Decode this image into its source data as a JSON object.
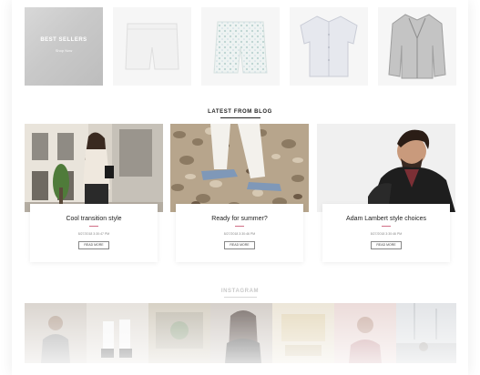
{
  "best_sellers": {
    "title": "BEST SELLERS",
    "link": "Shop Now"
  },
  "products": [
    {
      "name": "white-shorts"
    },
    {
      "name": "patterned-shorts"
    },
    {
      "name": "white-shirt"
    },
    {
      "name": "leather-jacket"
    }
  ],
  "blog": {
    "heading": "LATEST FROM BLOG",
    "posts": [
      {
        "title": "Cool transition style",
        "date": "8/27/2018 3:30:47 PM",
        "button": "READ MORE"
      },
      {
        "title": "Ready for summer?",
        "date": "8/27/2018 3:30:46 PM",
        "button": "READ MORE"
      },
      {
        "title": "Adam Lambert style choices",
        "date": "8/27/2018 3:30:46 PM",
        "button": "READ MORE"
      }
    ]
  },
  "instagram": {
    "heading": "INSTAGRAM"
  },
  "colors": {
    "accent": "#d06e86",
    "text": "#222222"
  }
}
